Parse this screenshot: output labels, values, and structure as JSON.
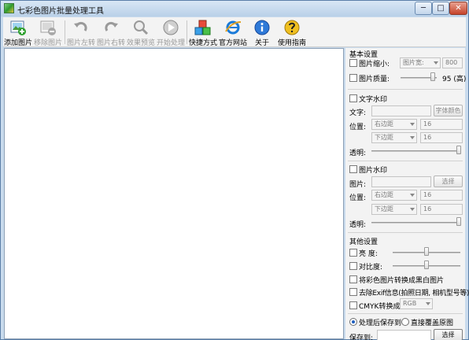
{
  "window": {
    "title": "七彩色图片批量处理工具",
    "controls": {
      "minimize": "─",
      "maximize": "□",
      "close": "✕"
    }
  },
  "toolbar": {
    "items": [
      {
        "label": "添加图片",
        "icon": "add-image-icon",
        "enabled": true
      },
      {
        "label": "移除图片",
        "icon": "remove-image-icon",
        "enabled": false
      },
      {
        "label": "图片左转",
        "icon": "rotate-left-icon",
        "enabled": false
      },
      {
        "label": "图片右转",
        "icon": "rotate-right-icon",
        "enabled": false
      },
      {
        "label": "效果预览",
        "icon": "preview-magnifier-icon",
        "enabled": false
      },
      {
        "label": "开始处理",
        "icon": "play-icon",
        "enabled": false
      },
      {
        "label": "快捷方式",
        "icon": "shortcut-cubes-icon",
        "enabled": true
      },
      {
        "label": "官方网站",
        "icon": "browser-icon",
        "enabled": true
      },
      {
        "label": "关于",
        "icon": "info-icon",
        "enabled": true
      },
      {
        "label": "使用指南",
        "icon": "help-icon",
        "enabled": true
      }
    ]
  },
  "panel": {
    "basic": {
      "title": "基本设置",
      "resize_label": "图片缩小:",
      "resize_mode": "图片宽:",
      "resize_value": "800",
      "quality_label": "图片质量:",
      "quality_value": "95 (高)",
      "quality_level": 0.95
    },
    "text_watermark": {
      "title": "文字水印",
      "text_label": "文字:",
      "text_value": "",
      "font_color_button": "字体颜色",
      "position_label": "位置:",
      "h_align": "右边距",
      "h_offset": "16",
      "v_align": "下边距",
      "v_offset": "16",
      "opacity_label": "透明:",
      "opacity_level": 1.0
    },
    "image_watermark": {
      "title": "图片水印",
      "image_label": "图片:",
      "image_value": "",
      "choose_button": "选择",
      "position_label": "位置:",
      "h_align": "右边距",
      "h_offset": "16",
      "v_align": "下边距",
      "v_offset": "16",
      "opacity_label": "透明:",
      "opacity_level": 1.0
    },
    "other": {
      "title": "其他设置",
      "brightness_label": "亮    度:",
      "brightness_level": 0.5,
      "contrast_label": "对比度:",
      "contrast_level": 0.5,
      "grayscale_label": "将彩色图片转换成黑白图片",
      "exif_label": "去除Exif信息(拍照日期, 相机型号等)",
      "cmyk_label": "CMYK转换成:",
      "cmyk_value": "RGB"
    },
    "output": {
      "save_after_label": "处理后保存到",
      "overwrite_label": "直接覆盖原图",
      "save_to_label": "保存到:",
      "save_to_value": "",
      "choose_button": "选择"
    }
  }
}
